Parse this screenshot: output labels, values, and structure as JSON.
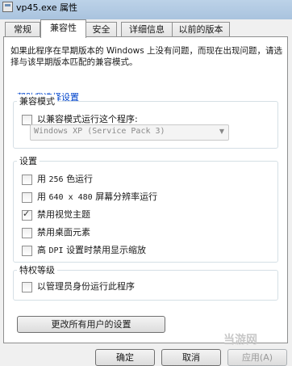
{
  "window": {
    "title": "vp45.exe 属性"
  },
  "tabs": [
    {
      "label": "常规"
    },
    {
      "label": "兼容性",
      "active": true
    },
    {
      "label": "安全"
    },
    {
      "label": "详细信息"
    },
    {
      "label": "以前的版本"
    }
  ],
  "description": "如果此程序在早期版本的 Windows 上没有问题，而现在出现问题，请选择与该早期版本匹配的兼容模式。",
  "help_link": "帮助我选择设置",
  "compat_mode": {
    "title": "兼容模式",
    "checkbox_label": "以兼容模式运行这个程序:",
    "checked": false,
    "select_value": "Windows XP (Service Pack 3)"
  },
  "settings": {
    "title": "设置",
    "options": [
      {
        "prefix": "用",
        "mono": "256",
        "suffix": "色运行",
        "checked": false
      },
      {
        "prefix": "用",
        "mono": "640 x 480",
        "suffix": "屏幕分辨率运行",
        "checked": false
      },
      {
        "label": "禁用视觉主题",
        "checked": true
      },
      {
        "label": "禁用桌面元素",
        "checked": false
      },
      {
        "prefix": "高",
        "mono": "DPI",
        "suffix": "设置时禁用显示缩放",
        "checked": false
      }
    ]
  },
  "privilege": {
    "title": "特权等级",
    "checkbox_label": "以管理员身份运行此程序",
    "checked": false
  },
  "buttons": {
    "change_all": "更改所有用户的设置",
    "ok": "确定",
    "cancel": "取消",
    "apply": "应用(A)"
  },
  "watermark": "当游网",
  "icons": {
    "check": "✓",
    "dropdown": "▼"
  }
}
